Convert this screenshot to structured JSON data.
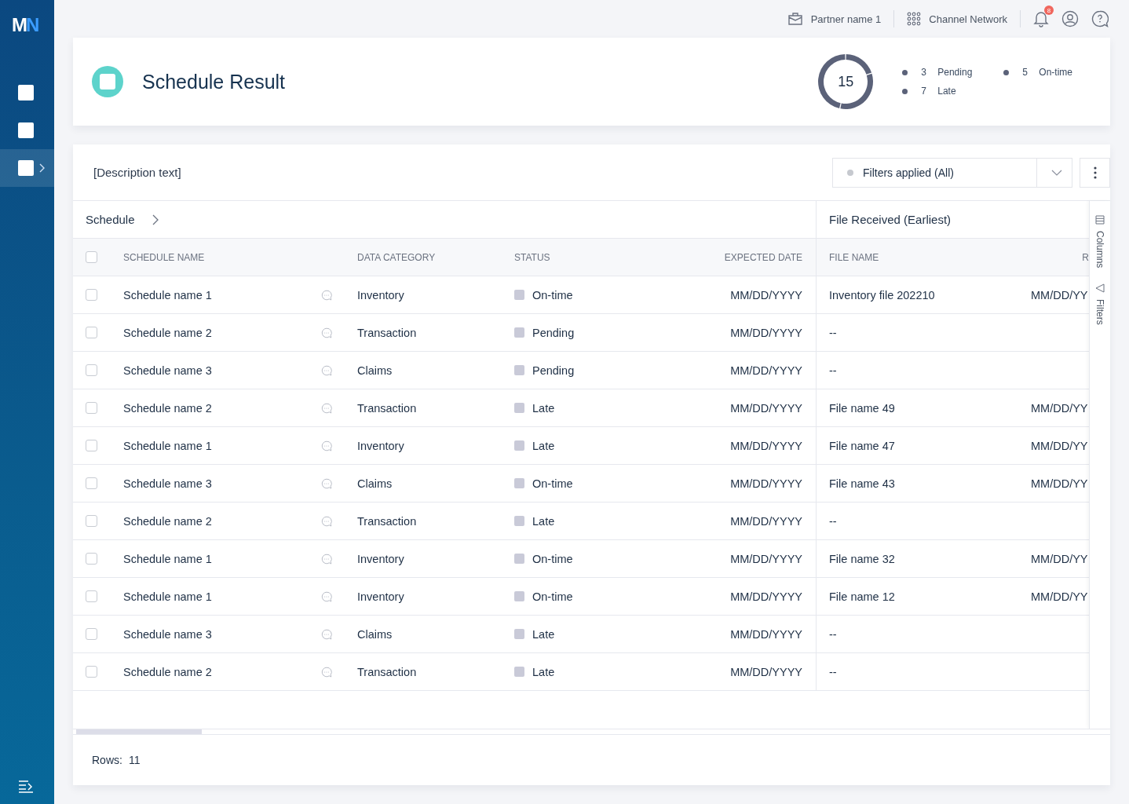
{
  "sidebar": {
    "logo": "MN",
    "items": [
      {
        "selected": false
      },
      {
        "selected": false
      },
      {
        "selected": true
      }
    ]
  },
  "topbar": {
    "partner": "Partner name 1",
    "network": "Channel Network",
    "notifications_badge": "8"
  },
  "summary": {
    "title": "Schedule Result",
    "total": "15",
    "legend": [
      {
        "count": "3",
        "label": "Pending"
      },
      {
        "count": "5",
        "label": "On-time"
      },
      {
        "count": "7",
        "label": "Late"
      }
    ]
  },
  "table": {
    "description": "[Description text]",
    "filter": {
      "label": "Filters applied (All)"
    },
    "groups": [
      "Schedule",
      "File Received (Earliest)"
    ],
    "columns": [
      "SCHEDULE NAME",
      "DATA CATEGORY",
      "STATUS",
      "EXPECTED DATE",
      "FILE NAME",
      "R"
    ],
    "header_checked": false,
    "rows": [
      {
        "checked": false,
        "name": "Schedule name 1",
        "category": "Inventory",
        "status": "On-time",
        "expected": "MM/DD/YYYY",
        "file_name": "Inventory file 202210",
        "received": "MM/DD/YY"
      },
      {
        "checked": false,
        "name": "Schedule name 2",
        "category": "Transaction",
        "status": "Pending",
        "expected": "MM/DD/YYYY",
        "file_name": "--"
      },
      {
        "checked": false,
        "name": "Schedule name 3",
        "category": "Claims",
        "status": "Pending",
        "expected": "MM/DD/YYYY",
        "file_name": "--"
      },
      {
        "checked": false,
        "name": "Schedule name 2",
        "category": "Transaction",
        "status": "Late",
        "expected": "MM/DD/YYYY",
        "file_name": "File name 49",
        "received": "MM/DD/YY"
      },
      {
        "checked": false,
        "name": "Schedule name 1",
        "category": "Inventory",
        "status": "Late",
        "expected": "MM/DD/YYYY",
        "file_name": "File name 47",
        "received": "MM/DD/YY"
      },
      {
        "checked": false,
        "name": "Schedule name 3",
        "category": "Claims",
        "status": "On-time",
        "expected": "MM/DD/YYYY",
        "file_name": "File name 43",
        "received": "MM/DD/YY"
      },
      {
        "checked": false,
        "name": "Schedule name 2",
        "category": "Transaction",
        "status": "Late",
        "expected": "MM/DD/YYYY",
        "file_name": "--"
      },
      {
        "checked": false,
        "name": "Schedule name 1",
        "category": "Inventory",
        "status": "On-time",
        "expected": "MM/DD/YYYY",
        "file_name": "File name 32",
        "received": "MM/DD/YY"
      },
      {
        "checked": false,
        "name": "Schedule name 1",
        "category": "Inventory",
        "status": "On-time",
        "expected": "MM/DD/YYYY",
        "file_name": "File name 12",
        "received": "MM/DD/YY"
      },
      {
        "checked": false,
        "name": "Schedule name 3",
        "category": "Claims",
        "status": "Late",
        "expected": "MM/DD/YYYY",
        "file_name": "--"
      },
      {
        "checked": false,
        "name": "Schedule name 2",
        "category": "Transaction",
        "status": "Late",
        "expected": "MM/DD/YYYY",
        "file_name": "--"
      }
    ],
    "side_panel": [
      "Columns",
      "Filters"
    ],
    "footer_label": "Rows:",
    "footer_count": "11"
  }
}
